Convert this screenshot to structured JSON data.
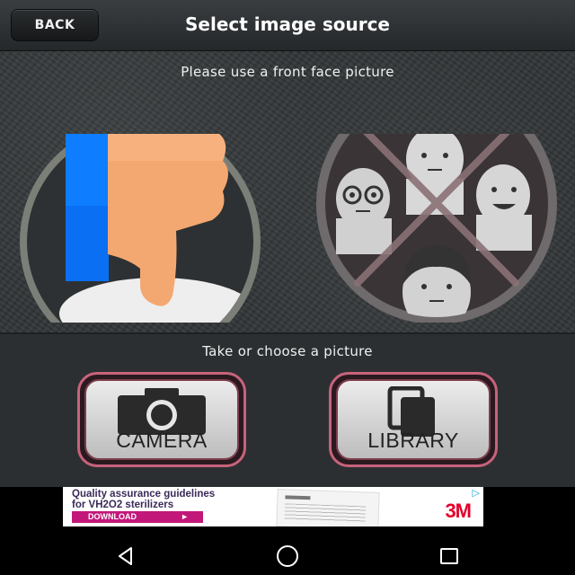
{
  "header": {
    "back_label": "BACK",
    "title": "Select image source"
  },
  "face_panel": {
    "hint": "Please use a front face picture",
    "good_example": {
      "overlay": "thumb-down-icon"
    },
    "bad_example": {
      "overlay": "cross-out-icon"
    }
  },
  "action_panel": {
    "hint": "Take or choose a picture",
    "camera_label": "CAMERA",
    "library_label": "LIBRARY",
    "accent_color": "#c7637c"
  },
  "ad": {
    "line1": "Quality assurance guidelines",
    "line2": "for VH2O2 sterilizers",
    "cta": "DOWNLOAD",
    "brand": "3M",
    "choices_icon": "ad-choices-icon"
  },
  "nav": {
    "back_icon": "nav-back-icon",
    "home_icon": "nav-home-icon",
    "recents_icon": "nav-recents-icon"
  }
}
